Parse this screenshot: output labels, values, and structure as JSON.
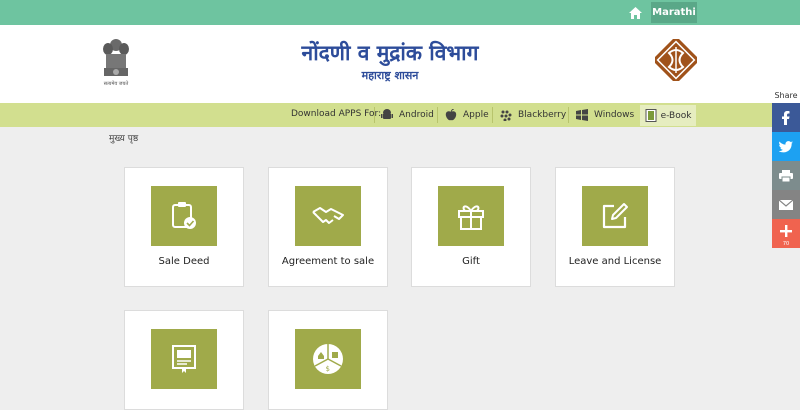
{
  "topbar": {
    "language": "Marathi"
  },
  "header": {
    "title": "नोंदणी व मुद्रांक विभाग",
    "subtitle": "महाराष्ट्र शासन",
    "emblem_label": "सत्यमेव जयते"
  },
  "apps": {
    "label": "Download APPS For:",
    "items": [
      {
        "label": "Android",
        "icon": "android-icon"
      },
      {
        "label": "Apple",
        "icon": "apple-icon"
      },
      {
        "label": "Blackberry",
        "icon": "blackberry-icon"
      },
      {
        "label": "Windows",
        "icon": "windows-icon"
      },
      {
        "label": "e-Book",
        "icon": "ebook-icon"
      }
    ]
  },
  "breadcrumb": "मुख्य पृष्ठ",
  "cards": [
    {
      "label": "Sale Deed",
      "icon": "clipboard-check-icon"
    },
    {
      "label": "Agreement to sale",
      "icon": "handshake-icon"
    },
    {
      "label": "Gift",
      "icon": "gift-icon"
    },
    {
      "label": "Leave and License",
      "icon": "edit-icon"
    },
    {
      "label": "",
      "icon": "certificate-icon"
    },
    {
      "label": "",
      "icon": "property-pie-icon"
    }
  ],
  "share": {
    "title": "Share",
    "count": "70",
    "colors": {
      "facebook": "#3b5998",
      "twitter": "#1da1f2",
      "print": "#7d8c8d",
      "email": "#848484",
      "more": "#f0634f"
    }
  },
  "colors": {
    "topbar": "#6ec4a0",
    "appsbar": "#d2df8f",
    "tile": "#a0aa4a",
    "title": "#2d4c9a"
  }
}
